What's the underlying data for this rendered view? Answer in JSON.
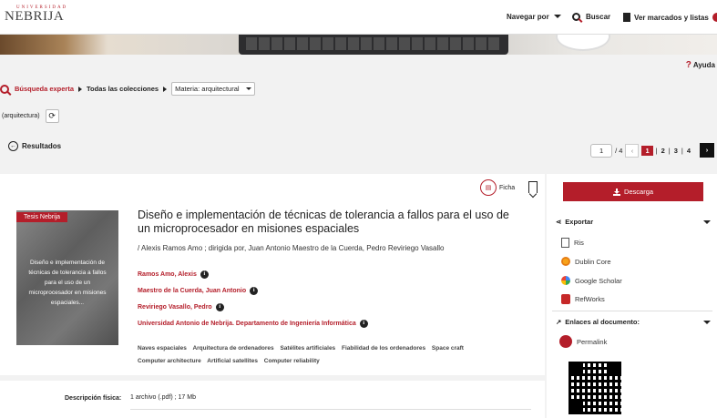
{
  "brand": {
    "small": "UNIVERSIDAD",
    "big": "NEBRIJA"
  },
  "topnav": {
    "browse": "Navegar por",
    "search": "Buscar",
    "marked": "Ver marcados y listas"
  },
  "help": "Ayuda",
  "breadcrumb": {
    "advanced": "Búsqueda experta",
    "collections": "Todas las colecciones",
    "materia": "Materia: arquitectural"
  },
  "filter_chip": "(arquitectura)",
  "results": {
    "title": "Resultados",
    "current_page": "1",
    "total_label": "/ 4",
    "pages": [
      "1",
      "2",
      "3",
      "4"
    ],
    "prev": "‹",
    "next": "›"
  },
  "record": {
    "tag": "Tesis Nebrija",
    "thumb_text": "Diseño e implementación de técnicas de tolerancia a fallos para el uso de un microprocesador en misiones espaciales...",
    "title": "Diseño e implementación de técnicas de tolerancia a fallos para el uso de un microprocesador en misiones espaciales",
    "authors_line": "/ Alexis Ramos Amo ; dirigida por, Juan Antonio Maestro de la Cuerda, Pedro Reviriego Vasallo",
    "people": [
      "Ramos Amo, Alexis",
      "Maestro de la Cuerda, Juan Antonio",
      "Reviriego Vasallo, Pedro",
      "Universidad Antonio de Nebrija. Departamento de Ingeniería Informática"
    ],
    "subjects": [
      "Naves espaciales",
      "Arquitectura de ordenadores",
      "Satélites artificiales",
      "Fiabilidad de los ordenadores",
      "Space craft",
      "Computer architecture",
      "Artificial satellites",
      "Computer reliability"
    ],
    "ficha": "Ficha",
    "desc_label": "Descripción física:",
    "desc_value": "1 archivo (.pdf) ; 17 Mb"
  },
  "sidebar": {
    "download": "Descarga",
    "export": "Exportar",
    "export_items": [
      "Ris",
      "Dublin Core",
      "Google Scholar",
      "RefWorks"
    ],
    "links": "Enlaces al documento:",
    "permalink": "Permalink"
  }
}
